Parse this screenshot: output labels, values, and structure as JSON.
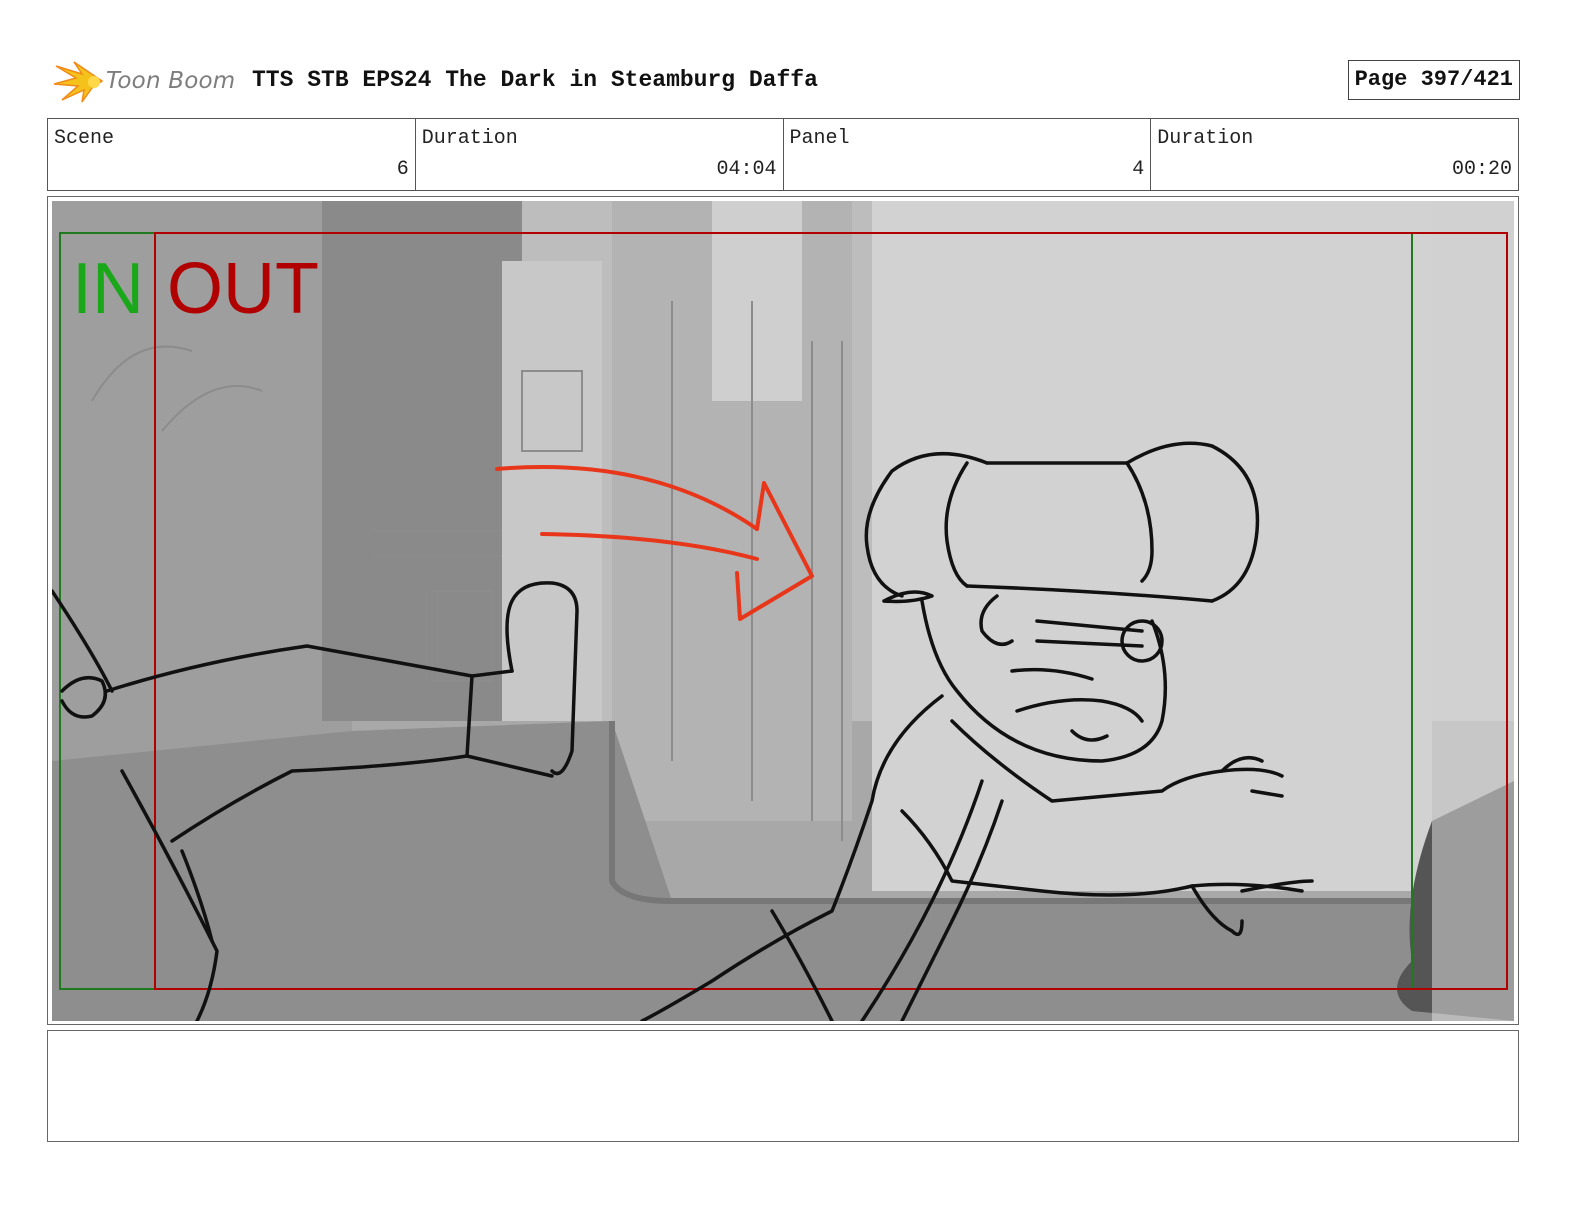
{
  "header": {
    "logo_text": "Toon Boom",
    "title": "TTS STB EPS24 The Dark in Steamburg Daffa",
    "page": "Page 397/421"
  },
  "info": {
    "scene_label": "Scene",
    "scene_value": "6",
    "scene_duration_label": "Duration",
    "scene_duration_value": "04:04",
    "panel_label": "Panel",
    "panel_value": "4",
    "panel_duration_label": "Duration",
    "panel_duration_value": "00:20"
  },
  "panel": {
    "in_label": "IN",
    "out_label": "OUT",
    "colors": {
      "in": "#1aa81a",
      "out": "#b00000",
      "arrow": "#e8361a",
      "background": "#9a9a9a"
    }
  },
  "notes": {
    "text": ""
  }
}
